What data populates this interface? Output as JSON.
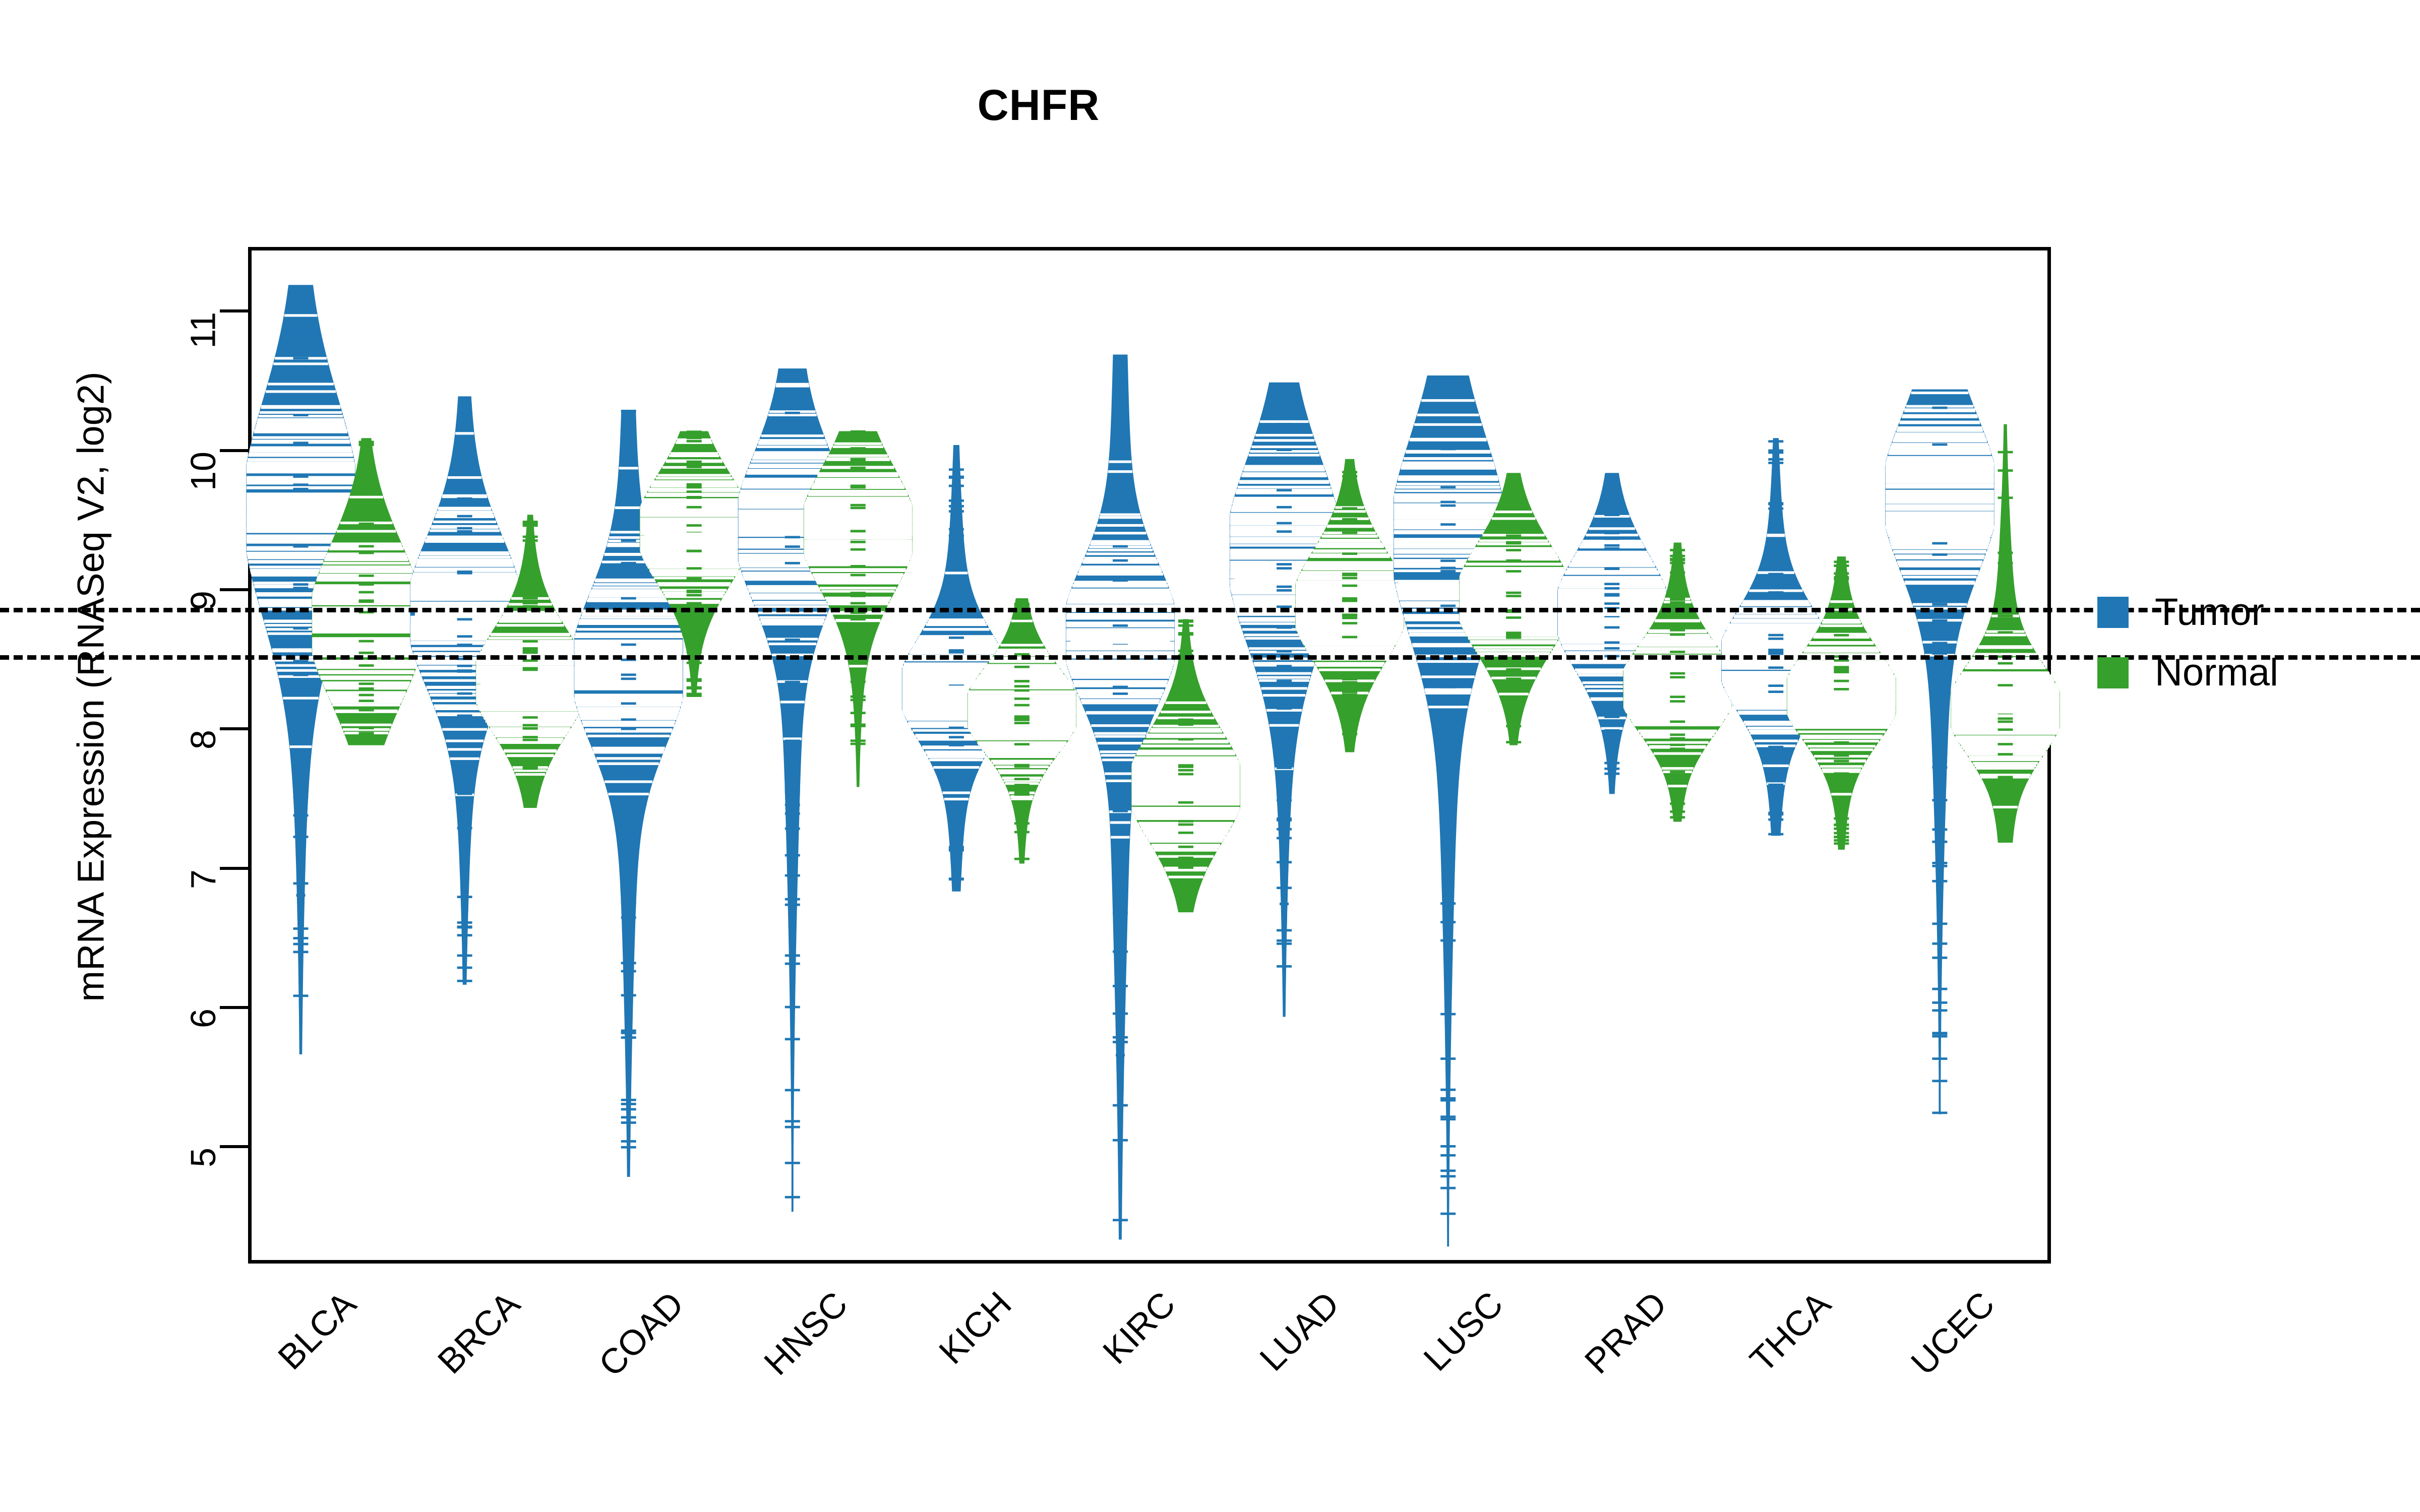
{
  "title": "CHFR",
  "axes": {
    "ylabel": "mRNA Expression (RNASeq V2, log2)",
    "xlabel": "",
    "yticks": [
      11,
      10,
      9,
      8,
      7,
      6,
      5
    ],
    "ytick_labels": [
      "11",
      "10",
      "9",
      "8",
      "7",
      "6",
      "5"
    ],
    "ylim": [
      4.15,
      11.45
    ],
    "xtick_labels": [
      "BLCA",
      "BRCA",
      "COAD",
      "HNSC",
      "KICH",
      "KIRC",
      "LUAD",
      "LUSC",
      "PRAD",
      "THCA",
      "UCEC"
    ]
  },
  "legend": {
    "position": "right",
    "entries": [
      {
        "label": "Tumor",
        "color": "#2077b4",
        "swatch": "square-swatch"
      },
      {
        "label": "Normal",
        "color": "#35a02c",
        "swatch": "square-swatch"
      }
    ]
  },
  "reference_lines": {
    "style": "dotted",
    "color": "#000000",
    "values": [
      8.86,
      8.52
    ]
  },
  "colors": {
    "tumor": "#2077b4",
    "normal": "#35a02c",
    "axis": "#000000",
    "background": "#ffffff"
  },
  "chart_data": {
    "type": "violin",
    "subtype": "beanplot",
    "title": "CHFR",
    "xlabel": "",
    "ylabel": "mRNA Expression (RNASeq V2, log2)",
    "ylim": [
      4.15,
      11.45
    ],
    "yticks": [
      5,
      6,
      7,
      8,
      9,
      10,
      11
    ],
    "grid": false,
    "legend_position": "right",
    "categories": [
      "BLCA",
      "BRCA",
      "COAD",
      "HNSC",
      "KICH",
      "KIRC",
      "LUAD",
      "LUSC",
      "PRAD",
      "THCA",
      "UCEC"
    ],
    "reference_lines": [
      8.86,
      8.52
    ],
    "series": [
      {
        "name": "Tumor",
        "color": "#2077b4",
        "groups": [
          {
            "category": "BLCA",
            "median": 9.55,
            "q1": 9.15,
            "q3": 9.85,
            "min": 5.68,
            "max": 11.2,
            "whisker_low": 7.7,
            "whisker_high": 11.2,
            "density_peak": 9.6,
            "bandwidth_hi": 10.25,
            "bandwidth_lo": 8.45
          },
          {
            "category": "BRCA",
            "median": 8.85,
            "q1": 8.4,
            "q3": 9.25,
            "min": 6.18,
            "max": 10.4,
            "whisker_low": 6.18,
            "whisker_high": 10.4,
            "density_peak": 8.85,
            "bandwidth_hi": 9.45,
            "bandwidth_lo": 8.2
          },
          {
            "category": "COAD",
            "median": 8.45,
            "q1": 8.05,
            "q3": 9.0,
            "min": 4.8,
            "max": 10.3,
            "whisker_low": 4.8,
            "whisker_high": 10.3,
            "density_peak": 8.45,
            "bandwidth_hi": 9.1,
            "bandwidth_lo": 7.85
          },
          {
            "category": "HNSC",
            "median": 9.45,
            "q1": 9.1,
            "q3": 9.8,
            "min": 4.55,
            "max": 10.6,
            "whisker_low": 6.6,
            "whisker_high": 10.6,
            "density_peak": 9.45,
            "bandwidth_hi": 10.05,
            "bandwidth_lo": 8.8
          },
          {
            "category": "KICH",
            "median": 8.3,
            "q1": 8.05,
            "q3": 8.6,
            "min": 6.85,
            "max": 10.05,
            "whisker_low": 6.85,
            "whisker_high": 10.05,
            "density_peak": 8.3,
            "bandwidth_hi": 8.7,
            "bandwidth_lo": 7.85
          },
          {
            "category": "KIRC",
            "median": 8.65,
            "q1": 8.35,
            "q3": 9.0,
            "min": 4.35,
            "max": 10.7,
            "whisker_low": 5.75,
            "whisker_high": 10.7,
            "density_peak": 8.7,
            "bandwidth_hi": 9.25,
            "bandwidth_lo": 8.1
          },
          {
            "category": "LUAD",
            "median": 9.1,
            "q1": 8.7,
            "q3": 9.55,
            "min": 5.95,
            "max": 10.5,
            "whisker_low": 6.75,
            "whisker_high": 10.5,
            "density_peak": 9.3,
            "bandwidth_hi": 9.95,
            "bandwidth_lo": 8.45
          },
          {
            "category": "LUSC",
            "median": 9.05,
            "q1": 8.7,
            "q3": 9.6,
            "min": 4.3,
            "max": 10.55,
            "whisker_low": 6.3,
            "whisker_high": 10.55,
            "density_peak": 9.4,
            "bandwidth_hi": 10.0,
            "bandwidth_lo": 8.35
          },
          {
            "category": "PRAD",
            "median": 8.85,
            "q1": 8.65,
            "q3": 9.1,
            "min": 7.55,
            "max": 9.85,
            "whisker_low": 7.8,
            "whisker_high": 9.85,
            "density_peak": 8.85,
            "bandwidth_hi": 9.3,
            "bandwidth_lo": 8.35
          },
          {
            "category": "THCA",
            "median": 8.5,
            "q1": 8.3,
            "q3": 8.75,
            "min": 7.25,
            "max": 10.1,
            "whisker_low": 7.25,
            "whisker_high": 9.7,
            "density_peak": 8.5,
            "bandwidth_hi": 8.95,
            "bandwidth_lo": 8.1
          },
          {
            "category": "UCEC",
            "median": 9.4,
            "q1": 9.05,
            "q3": 9.85,
            "min": 5.25,
            "max": 10.45,
            "whisker_low": 6.45,
            "whisker_high": 10.45,
            "density_peak": 9.7,
            "bandwidth_hi": 10.15,
            "bandwidth_lo": 8.85
          }
        ]
      },
      {
        "name": "Normal",
        "color": "#35a02c",
        "groups": [
          {
            "category": "BLCA",
            "median": 8.8,
            "q1": 8.45,
            "q3": 9.35,
            "min": 7.9,
            "max": 10.1,
            "whisker_low": 7.9,
            "whisker_high": 10.1,
            "density_peak": 8.75,
            "bandwidth_hi": 9.55,
            "bandwidth_lo": 8.25
          },
          {
            "category": "BRCA",
            "median": 8.35,
            "q1": 8.1,
            "q3": 8.65,
            "min": 7.45,
            "max": 9.55,
            "whisker_low": 7.45,
            "whisker_high": 9.55,
            "density_peak": 8.35,
            "bandwidth_hi": 8.8,
            "bandwidth_lo": 7.95
          },
          {
            "category": "COAD",
            "median": 9.4,
            "q1": 9.15,
            "q3": 9.7,
            "min": 8.25,
            "max": 10.15,
            "whisker_low": 8.25,
            "whisker_high": 10.15,
            "density_peak": 9.45,
            "bandwidth_hi": 9.85,
            "bandwidth_lo": 8.95
          },
          {
            "category": "HNSC",
            "median": 9.4,
            "q1": 9.05,
            "q3": 9.7,
            "min": 7.6,
            "max": 10.15,
            "whisker_low": 7.9,
            "whisker_high": 10.15,
            "density_peak": 9.45,
            "bandwidth_hi": 9.85,
            "bandwidth_lo": 8.85
          },
          {
            "category": "KICH",
            "median": 8.15,
            "q1": 7.9,
            "q3": 8.4,
            "min": 7.05,
            "max": 8.95,
            "whisker_low": 7.05,
            "whisker_high": 8.95,
            "density_peak": 8.15,
            "bandwidth_hi": 8.45,
            "bandwidth_lo": 7.75
          },
          {
            "category": "KIRC",
            "median": 7.55,
            "q1": 7.3,
            "q3": 7.9,
            "min": 6.7,
            "max": 8.8,
            "whisker_low": 6.7,
            "whisker_high": 8.8,
            "density_peak": 7.6,
            "bandwidth_hi": 8.05,
            "bandwidth_lo": 7.15
          },
          {
            "category": "LUAD",
            "median": 8.9,
            "q1": 8.55,
            "q3": 9.25,
            "min": 7.85,
            "max": 9.95,
            "whisker_low": 7.85,
            "whisker_high": 9.95,
            "density_peak": 8.9,
            "bandwidth_hi": 9.35,
            "bandwidth_lo": 8.45
          },
          {
            "category": "LUSC",
            "median": 8.9,
            "q1": 8.6,
            "q3": 9.3,
            "min": 7.9,
            "max": 9.85,
            "whisker_low": 7.9,
            "whisker_high": 9.85,
            "density_peak": 8.95,
            "bandwidth_hi": 9.4,
            "bandwidth_lo": 8.5
          },
          {
            "category": "PRAD",
            "median": 8.3,
            "q1": 8.1,
            "q3": 8.6,
            "min": 7.35,
            "max": 9.35,
            "whisker_low": 7.35,
            "whisker_high": 9.35,
            "density_peak": 8.3,
            "bandwidth_hi": 8.7,
            "bandwidth_lo": 7.95
          },
          {
            "category": "THCA",
            "median": 8.2,
            "q1": 8.0,
            "q3": 8.5,
            "min": 7.15,
            "max": 9.25,
            "whisker_low": 7.15,
            "whisker_high": 9.25,
            "density_peak": 8.25,
            "bandwidth_hi": 8.65,
            "bandwidth_lo": 7.9
          },
          {
            "category": "UCEC",
            "median": 8.15,
            "q1": 7.95,
            "q3": 8.45,
            "min": 7.2,
            "max": 10.2,
            "whisker_low": 7.2,
            "whisker_high": 10.2,
            "density_peak": 8.15,
            "bandwidth_hi": 8.6,
            "bandwidth_lo": 7.85
          }
        ]
      }
    ]
  }
}
